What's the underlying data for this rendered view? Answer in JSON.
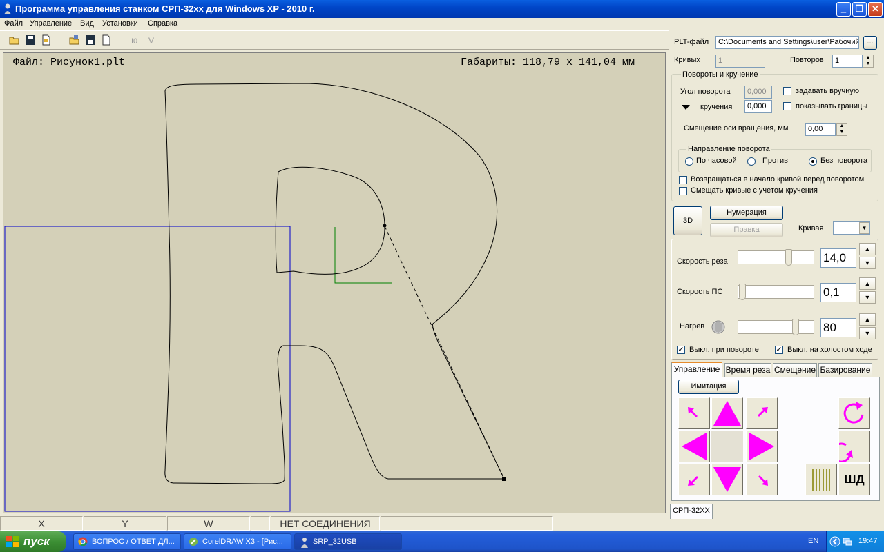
{
  "window": {
    "title": "Программа управления станком СРП-32хх для Windows XP - 2010 г."
  },
  "menu": [
    "Файл",
    "Управление",
    "Вид",
    "Установки",
    "Справка"
  ],
  "toolbar": {
    "icons": [
      "open-folder-icon",
      "save-icon",
      "export-icon",
      "open-multi-icon",
      "save-disk-icon",
      "new-file-icon",
      "io-icon",
      "v-icon"
    ]
  },
  "canvas": {
    "file_label": "Файл: Рисунок1.plt",
    "dimensions_label": "Габариты: 118,79 x 141,04 мм"
  },
  "status": {
    "x": "X",
    "y": "Y",
    "w": "W",
    "connection": "НЕТ СОЕДИНЕНИЯ"
  },
  "panel": {
    "plt_label": "PLT-файл",
    "plt_path": "C:\\Documents and Settings\\user\\Рабочий",
    "browse_label": "...",
    "curves_label": "Кривых",
    "curves_value": "1",
    "repeats_label": "Повторов",
    "repeats_value": "1",
    "rot_group_title": "Повороты и кручение",
    "angle_label": "Угол поворота",
    "angle_value": "0,000",
    "manual_label": "задавать вручную",
    "twist_label": "кручения",
    "twist_value": "0,000",
    "bounds_label": "показывать границы",
    "offset_label": "Смещение оси вращения, мм",
    "offset_value": "0,00",
    "dir_group_title": "Направление поворота",
    "dir_cw": "По часовой",
    "dir_ccw": "Против",
    "dir_none": "Без поворота",
    "return_label": "Возвращаться в начало кривой перед поворотом",
    "shift_label": "Смещать  кривые с учетом кручения",
    "btn_3d": "3D",
    "btn_numbering": "Нумерация",
    "btn_edit": "Правка",
    "curve_label": "Кривая",
    "cut_speed_label": "Скорость реза",
    "cut_speed_value": "14,0",
    "ps_speed_label": "Скорость ПС",
    "ps_speed_value": "0,1",
    "heat_label": "Нагрев",
    "heat_value": "80",
    "off_rotate_label": "Выкл. при повороте",
    "off_idle_label": "Выкл. на холостом ходе",
    "tabs": [
      "Управление",
      "Время реза",
      "Смещение",
      "Базирование"
    ],
    "btn_imitation": "Имитация",
    "btn_shd": "ШД",
    "footer_tab": "СРП-32XX"
  },
  "sliders": {
    "cut_speed_fraction": 0.68,
    "ps_speed_fraction": 0.0,
    "heat_fraction": 0.78
  },
  "colors": {
    "accent_magenta": "#ff00ff",
    "viewport_blue": "#0000cc",
    "axis_green": "#008000"
  },
  "taskbar": {
    "start": "пуск",
    "tasks": [
      "ВОПРОС / ОТВЕТ ДЛ...",
      "CorelDRAW X3 - [Рис...",
      "SRP_32USB"
    ],
    "lang": "EN",
    "clock": "19:47"
  }
}
